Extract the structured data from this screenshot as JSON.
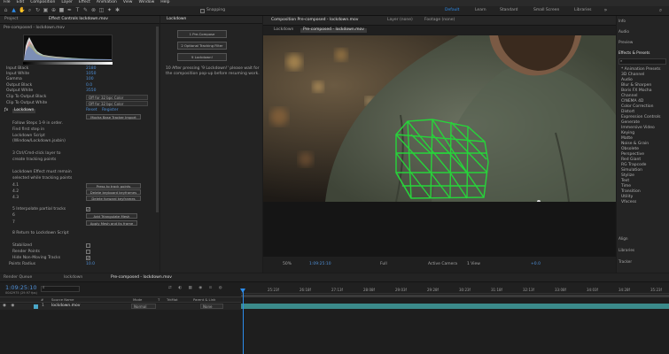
{
  "menu": [
    "File",
    "Edit",
    "Composition",
    "Layer",
    "Effect",
    "Animation",
    "View",
    "Window",
    "Help"
  ],
  "toolbar": {
    "snapping": "Snapping",
    "workspaces": [
      "Default",
      "Learn",
      "Standard",
      "Small Screen",
      "Libraries"
    ],
    "search_icon": "search-icon"
  },
  "left_panel": {
    "tabs": [
      "Project",
      "Effect Controls lockdown.mov"
    ],
    "layer_path": "Pre-composed - lockdown.mov",
    "properties": [
      {
        "label": "Input Black",
        "value": "2180"
      },
      {
        "label": "Input White",
        "value": "1050"
      },
      {
        "label": "Gamma",
        "value": "100"
      },
      {
        "label": "Output Black",
        "value": "0.0"
      },
      {
        "label": "Output White",
        "value": "3550"
      }
    ],
    "clip_black": "Clip To Output Black",
    "clip_white": "Clip To Output White",
    "clip_option": "Off for 32 bpc Color",
    "effect_name": "Lockdown",
    "reset": "Reset",
    "register": "Register",
    "mocha_btn": "Mocha Base Tracker Import",
    "steps": [
      "Follow Steps 1-9 in order.",
      "Find first step in",
      "Lockdown Script",
      "(Window/Lockdown.jsxbin)",
      "",
      "3 Ctrl/Cmd-click layer to",
      "create tracking points",
      "",
      "Lockdown Effect must remain",
      "selected while tracking points"
    ],
    "row_labels": [
      "4.1",
      "4.2",
      "4.3"
    ],
    "buttons": [
      "Press to track points",
      "Delete keyboard keyframes",
      "Delete forward keyframes"
    ],
    "interp": "5 Interpolate partial tracks",
    "step6": "6",
    "step7": "7",
    "add_mesh": "Add Triangulate Mesh",
    "apply_mesh": "Apply Mesh and its frame",
    "return": "8 Return to Lockdown Script",
    "stabilized": "Stabilized",
    "render_points": "Render Points",
    "hide_nm": "Hide Non-Moving Tracks",
    "points_radius": "Points Radius",
    "points_radius_value": "10.0"
  },
  "lockdown_panel": {
    "title": "Lockdown",
    "buttons": [
      "1 Pre-Compose",
      "2 Optional Tracking Filter",
      "9 Lockdown!"
    ],
    "note": "10 After pressing '9 Lockdown!' please wait for the composition pop-up before resuming work."
  },
  "comp_panel": {
    "tab": "Composition Pre-composed - lockdown.mov",
    "layer_tab": "Layer (none)",
    "footage_tab": "Footage (none)",
    "crumbs": [
      "Lockdown",
      "Pre-composed - lockdown.mov"
    ],
    "zoom": "50%",
    "timecode": "1:09:25:10",
    "resolution": "Full",
    "camera": "Active Camera",
    "view": "1 View",
    "exposure": "+0.0"
  },
  "right_panel": {
    "top_items": [
      "Info",
      "Audio",
      "Preview",
      "Effects & Presets"
    ],
    "search_placeholder": "",
    "effects": [
      "* Animation Presets",
      "3D Channel",
      "Audio",
      "Blur & Sharpen",
      "Boris FX Mocha",
      "Channel",
      "CINEMA 4D",
      "Color Correction",
      "Distort",
      "Expression Controls",
      "Generate",
      "Immersive Video",
      "Keying",
      "Matte",
      "Noise & Grain",
      "Obsolete",
      "Perspective",
      "Red Giant",
      "RG Trapcode",
      "Simulation",
      "Stylize",
      "Text",
      "Time",
      "Transition",
      "Utility",
      "Vfxcess"
    ],
    "bottom_items": [
      "Align",
      "Libraries",
      "Tracker"
    ]
  },
  "timeline": {
    "tabs": [
      "Render Queue",
      "lockdown",
      "Pre-composed - lockdown.mov"
    ],
    "timecode": "1:09:25:10",
    "sub": "0042975 (29.97 fps)",
    "columns": [
      "#",
      "Source Name",
      "Mode",
      "T",
      "TrkMat",
      "Parent & Link"
    ],
    "layer": {
      "num": "1",
      "name": "lockdown.mov",
      "mode": "Normal",
      "parent": "None"
    },
    "ruler": [
      "25:23f",
      "26:18f",
      "27:13f",
      "28:08f",
      "29:03f",
      "29:28f",
      "30:23f",
      "31:18f",
      "32:13f",
      "33:08f",
      "34:03f",
      "34:28f",
      "35:23f"
    ]
  },
  "colors": {
    "accent": "#2d8ceb",
    "mesh": "#27d43a",
    "value": "#4f8fd6"
  }
}
